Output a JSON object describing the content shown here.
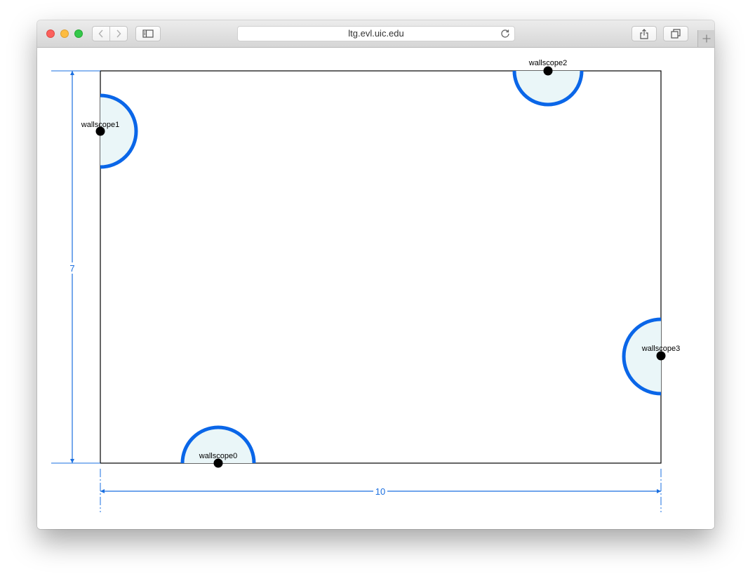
{
  "browser": {
    "url": "ltg.evl.uic.edu",
    "icons": {
      "back": "chevron-left-icon",
      "forward": "chevron-right-icon",
      "sidebar": "sidebar-icon",
      "reload": "reload-icon",
      "share": "share-icon",
      "tabs": "tab-overview-icon",
      "new_tab": "plus-icon"
    }
  },
  "room": {
    "width_label": "10",
    "height_label": "7",
    "colors": {
      "outline": "#000000",
      "dimension": "#1a6fe0",
      "scope_stroke": "#0a66e8",
      "scope_fill": "#eaf6f8",
      "sensor": "#000000"
    }
  },
  "wallscopes": [
    {
      "name": "wallscope0"
    },
    {
      "name": "wallscope1"
    },
    {
      "name": "wallscope2"
    },
    {
      "name": "wallscope3"
    }
  ]
}
